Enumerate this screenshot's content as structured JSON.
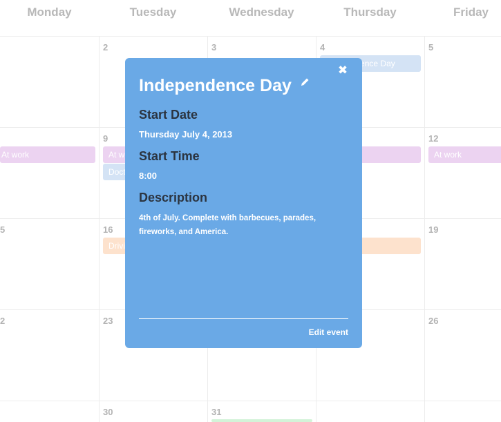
{
  "calendar": {
    "day_headers": [
      "Monday",
      "Tuesday",
      "Wednesday",
      "Thursday",
      "Friday"
    ],
    "day_numbers": {
      "r1": [
        "2",
        "3",
        "4",
        "5"
      ],
      "r2": [
        "9",
        "12"
      ],
      "r3": [
        "5",
        "16",
        "19"
      ],
      "r4": [
        "2",
        "23",
        "26"
      ],
      "r5": [
        "30",
        "31"
      ]
    },
    "events": {
      "thu_independence": "Independence Day",
      "mon_work": "At work",
      "tue_work": "At work",
      "fri_work": "At work",
      "tue_doctor": "Doctor",
      "tue_driving": "Driving"
    },
    "colors": {
      "purple": "#ecd3f1",
      "blue": "#d4e3f5",
      "orange": "#fde2cd",
      "green": "#d3f3d8"
    }
  },
  "popover": {
    "title": "Independence Day",
    "start_date_label": "Start Date",
    "start_date_value": "Thursday July 4, 2013",
    "start_time_label": "Start Time",
    "start_time_value": "8:00",
    "description_label": "Description",
    "description_value": "4th of July. Complete with barbecues, parades, fireworks, and America.",
    "edit_label": "Edit event",
    "close_glyph": "✖",
    "background": "#6aa9e6"
  }
}
